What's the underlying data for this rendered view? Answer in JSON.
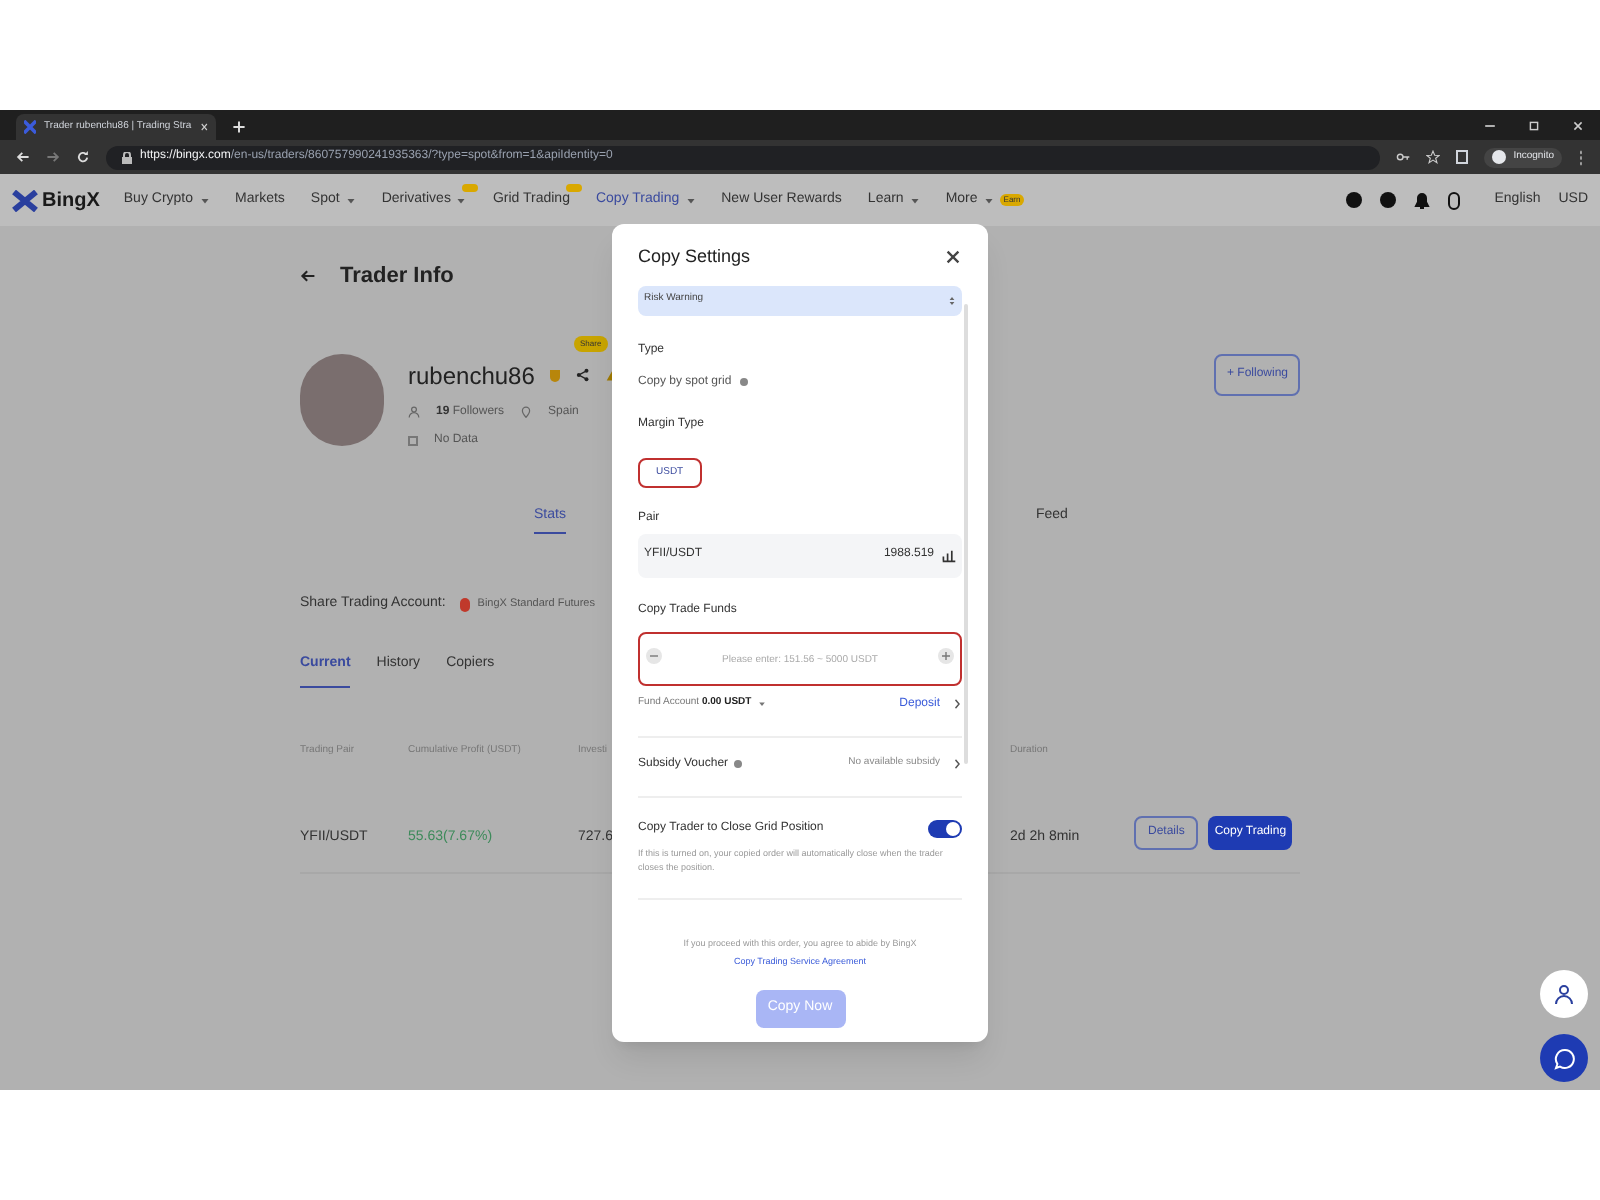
{
  "browser": {
    "tab_title": "Trader rubenchu86 | Trading Stra",
    "url_host": "https://bingx.com",
    "url_path": "/en-us/traders/860757990241935363/?type=spot&from=1&apiIdentity=0",
    "profile_label": "Incognito"
  },
  "nav": {
    "logo": "BingX",
    "items": [
      {
        "label": "Buy Crypto",
        "has_menu": true,
        "hot_tag": false,
        "selected": false
      },
      {
        "label": "Markets",
        "has_menu": false,
        "hot_tag": false,
        "selected": false
      },
      {
        "label": "Spot",
        "has_menu": true,
        "hot_tag": false,
        "selected": false
      },
      {
        "label": "Derivatives",
        "has_menu": true,
        "hot_tag": true,
        "selected": false
      },
      {
        "label": "Grid Trading",
        "has_menu": false,
        "hot_tag": true,
        "selected": false
      },
      {
        "label": "Copy Trading",
        "has_menu": true,
        "hot_tag": false,
        "selected": true
      },
      {
        "label": "New User Rewards",
        "has_menu": false,
        "hot_tag": false,
        "selected": false
      },
      {
        "label": "Learn",
        "has_menu": true,
        "hot_tag": false,
        "selected": false
      },
      {
        "label": "More",
        "has_menu": true,
        "hot_tag": false,
        "selected": false,
        "badge": "Earn"
      }
    ],
    "language": "English",
    "currency": "USD"
  },
  "trader": {
    "back_title": "Trader Info",
    "name": "rubenchu86",
    "share_badge": "Share",
    "followers_count": "19",
    "followers_label": "Followers",
    "country": "Spain",
    "bio": "No Data",
    "follow_button": "+ Following"
  },
  "tabs": [
    {
      "label": "Stats",
      "selected": true
    },
    {
      "label": "Feed",
      "selected": false
    }
  ],
  "share_account": {
    "label": "Share Trading Account:",
    "account": "BingX Standard Futures"
  },
  "list_tabs": [
    {
      "label": "Current",
      "selected": true
    },
    {
      "label": "History",
      "selected": false
    },
    {
      "label": "Copiers",
      "selected": false
    }
  ],
  "table": {
    "columns": [
      "Trading Pair",
      "Cumulative Profit (USDT)",
      "Investi",
      "Duration"
    ],
    "rows": [
      {
        "pair": "YFII/USDT",
        "profit": "55.63(7.67%)",
        "invest": "727.6",
        "duration": "2d 2h 8min",
        "buttons": [
          "Details",
          "Copy Trading"
        ]
      }
    ]
  },
  "modal": {
    "title": "Copy Settings",
    "risk_warning": "Risk Warning",
    "type_label": "Type",
    "type_value": "Copy by spot grid",
    "margin_label": "Margin Type",
    "margin_value": "USDT",
    "pair_label": "Pair",
    "pair": "YFII/USDT",
    "pair_price": "1988.519",
    "funds_label": "Copy Trade Funds",
    "funds_placeholder": "Please enter: 151.56 ~ 5000 USDT",
    "fund_account_label": "Fund Account",
    "fund_account_value": "0.00 USDT",
    "deposit": "Deposit",
    "voucher_label": "Subsidy Voucher",
    "voucher_value": "No available subsidy",
    "close_label": "Copy Trader to Close Grid Position",
    "close_on": true,
    "close_note": "If this is turned on, your copied order will automatically close when the trader closes the position.",
    "agreement": "If you proceed with this order, you agree to abide by BingX",
    "agreement_link": "Copy Trading Service Agreement",
    "submit": "Copy Now",
    "submit_disabled": true
  }
}
